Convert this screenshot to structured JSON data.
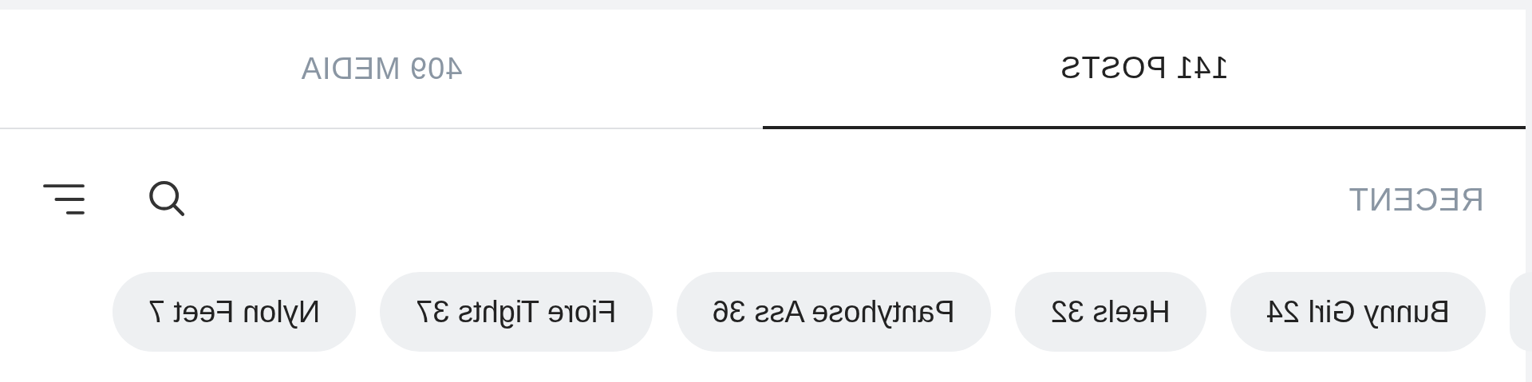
{
  "tabs": [
    {
      "label": "409 MEDIA",
      "selected": false
    },
    {
      "label": "141 POSTS",
      "selected": true
    }
  ],
  "sort_label": "RECENT",
  "chips": [
    {
      "label": "Nylon Feet 7"
    },
    {
      "label": "Fiore Tights 37"
    },
    {
      "label": "Pantyhose Ass 36"
    },
    {
      "label": "Heels 32"
    },
    {
      "label": "Bunny Girl 24"
    }
  ]
}
